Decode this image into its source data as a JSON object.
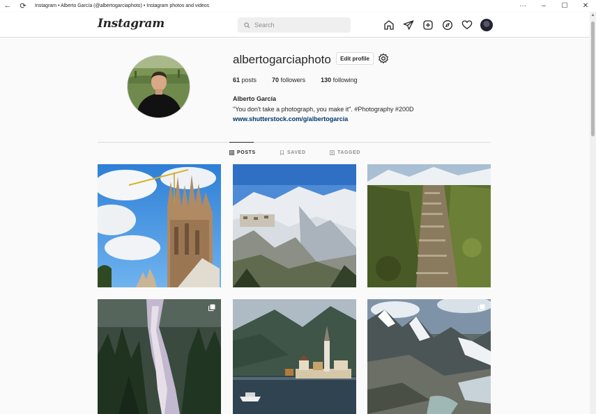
{
  "window": {
    "title": "Instagram • Alberto García (@albertogarciaphoto) • Instagram photos and videos",
    "back_icon": "←",
    "refresh_icon": "⟳",
    "more_icon": "···",
    "minimize_icon": "–",
    "maximize_icon": "☐",
    "close_icon": "✕"
  },
  "nav": {
    "logo": "Instagram",
    "search_placeholder": "Search"
  },
  "profile": {
    "username": "albertogarciaphoto",
    "edit_label": "Edit profile",
    "posts_count": "61",
    "posts_label": "posts",
    "followers_count": "70",
    "followers_label": "followers",
    "following_count": "130",
    "following_label": "following",
    "full_name": "Alberto García",
    "bio": "\"You don't take a photograph, you make it\". #Photography #200D",
    "link": "www.shutterstock.com/g/albertogarcia"
  },
  "tabs": [
    {
      "label": "POSTS",
      "active": true
    },
    {
      "label": "SAVED",
      "active": false
    },
    {
      "label": "TAGGED",
      "active": false
    }
  ],
  "posts": [
    {
      "subject": "sagrada-familia",
      "multi": false
    },
    {
      "subject": "snowy-mountain-village",
      "multi": false
    },
    {
      "subject": "mountain-stone-steps",
      "multi": false
    },
    {
      "subject": "forest-waterfall",
      "multi": true
    },
    {
      "subject": "hallstatt-lake-village",
      "multi": false
    },
    {
      "subject": "glacier-mountains",
      "multi": true
    }
  ],
  "colors": {
    "background": "#fafafa",
    "border": "#dbdbdb",
    "text": "#262626",
    "muted": "#8e8e8e",
    "link": "#00376b"
  }
}
